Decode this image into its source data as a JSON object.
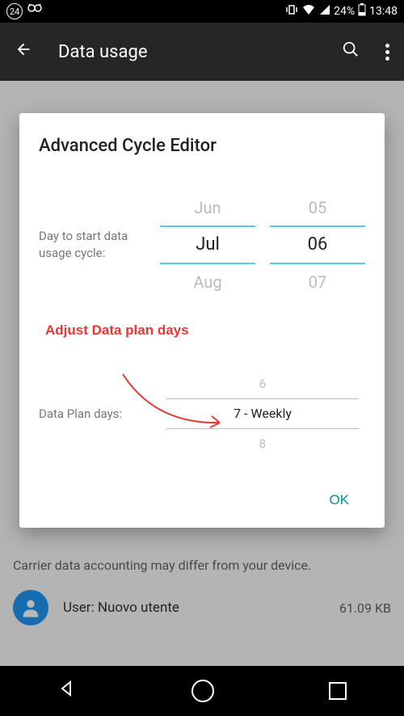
{
  "status_bar": {
    "badge": "24",
    "battery_percent": "24%",
    "time": "13:48"
  },
  "action_bar": {
    "title": "Data usage"
  },
  "background": {
    "carrier_note": "Carrier data accounting may differ from your device.",
    "user_label": "User: Nuovo utente",
    "user_size": "61.09 KB"
  },
  "dialog": {
    "title": "Advanced Cycle Editor",
    "start_label": "Day to start data usage cycle:",
    "month_wheel": {
      "prev": "Jun",
      "current": "Jul",
      "next": "Aug"
    },
    "day_wheel": {
      "prev": "05",
      "current": "06",
      "next": "07"
    },
    "annotation": "Adjust Data plan days",
    "plan_label": "Data Plan days:",
    "plan_wheel": {
      "prev": "6",
      "current": "7 - Weekly",
      "next": "8"
    },
    "ok_label": "OK"
  },
  "nav": {}
}
